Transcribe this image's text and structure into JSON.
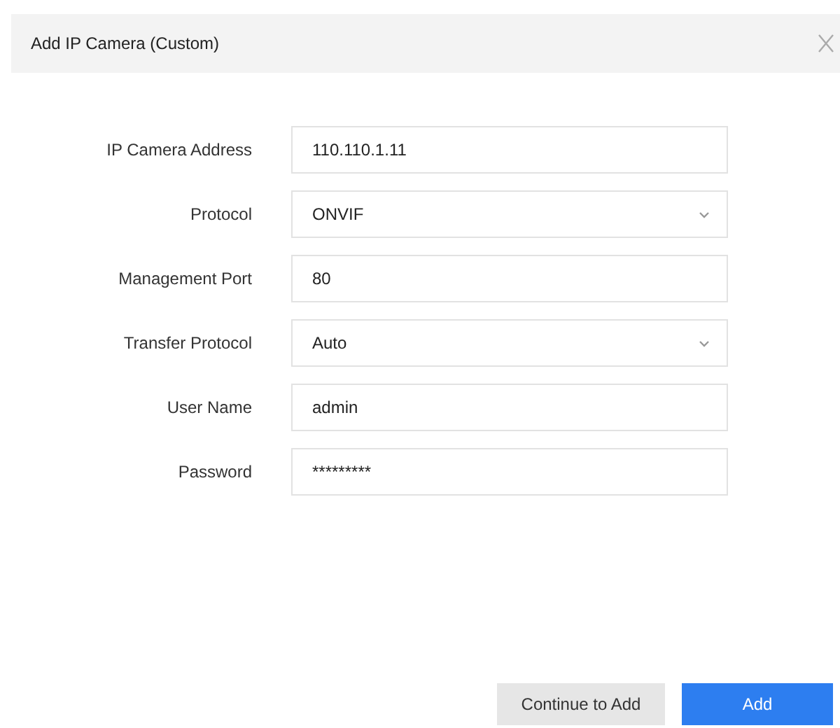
{
  "dialog": {
    "title": "Add IP Camera (Custom)"
  },
  "fields": [
    {
      "label": "IP Camera Address",
      "kind": "text",
      "value": "110.110.1.11"
    },
    {
      "label": "Protocol",
      "kind": "select",
      "value": "ONVIF"
    },
    {
      "label": "Management Port",
      "kind": "text",
      "value": "80"
    },
    {
      "label": "Transfer Protocol",
      "kind": "select",
      "value": "Auto"
    },
    {
      "label": "User Name",
      "kind": "text",
      "value": "admin"
    },
    {
      "label": "Password",
      "kind": "text",
      "value": "*********"
    }
  ],
  "buttons": [
    {
      "label": "Continue to Add",
      "kind": "secondary"
    },
    {
      "label": "Add",
      "kind": "primary"
    }
  ]
}
